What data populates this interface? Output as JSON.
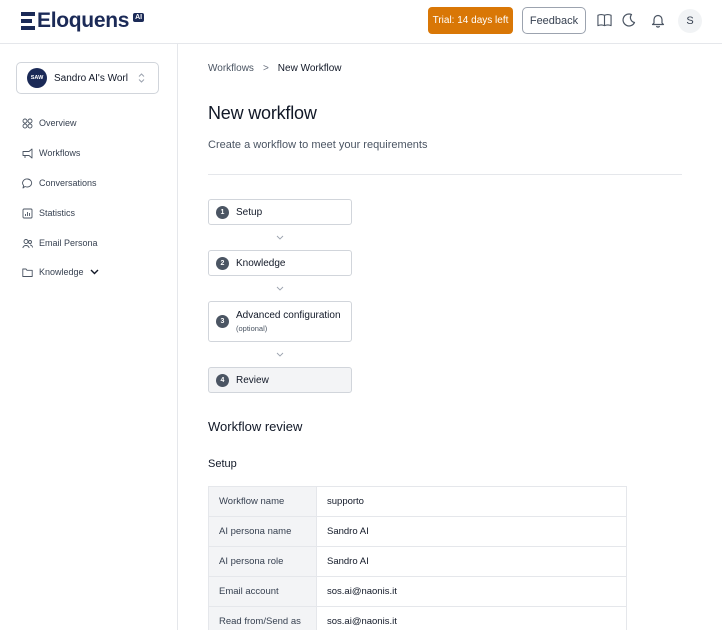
{
  "brand": {
    "name": "Eloquens",
    "badge": "AI"
  },
  "header": {
    "trial_label": "Trial: 14 days left",
    "feedback_label": "Feedback",
    "user_initial": "S",
    "icons": [
      "book-icon",
      "moon-icon",
      "bell-icon"
    ]
  },
  "sidebar": {
    "workspace": {
      "initials": "SAW",
      "name": "Sandro AI's Worl"
    },
    "items": [
      {
        "label": "Overview",
        "icon": "overview-icon"
      },
      {
        "label": "Workflows",
        "icon": "workflows-icon"
      },
      {
        "label": "Conversations",
        "icon": "chat-icon"
      },
      {
        "label": "Statistics",
        "icon": "statistics-icon"
      },
      {
        "label": "Email Persona",
        "icon": "persona-icon"
      },
      {
        "label": "Knowledge",
        "icon": "folder-icon"
      }
    ]
  },
  "breadcrumb": {
    "parent": "Workflows",
    "separator": ">",
    "current": "New Workflow"
  },
  "page": {
    "title": "New workflow",
    "subtitle": "Create a workflow to meet your requirements"
  },
  "steps": [
    {
      "num": "1",
      "label": "Setup",
      "note": ""
    },
    {
      "num": "2",
      "label": "Knowledge",
      "note": ""
    },
    {
      "num": "3",
      "label": "Advanced configuration",
      "note": "(optional)"
    },
    {
      "num": "4",
      "label": "Review",
      "note": ""
    }
  ],
  "review": {
    "title": "Workflow review",
    "section": "Setup",
    "rows": [
      {
        "key": "Workflow name",
        "value": "supporto"
      },
      {
        "key": "AI persona name",
        "value": "Sandro AI"
      },
      {
        "key": "AI persona role",
        "value": "Sandro AI"
      },
      {
        "key": "Email account",
        "value": "sos.ai@naonis.it"
      },
      {
        "key": "Read from/Send as",
        "value": "sos.ai@naonis.it"
      }
    ]
  },
  "colors": {
    "accent": "#d97706",
    "brand": "#1b2a57"
  }
}
